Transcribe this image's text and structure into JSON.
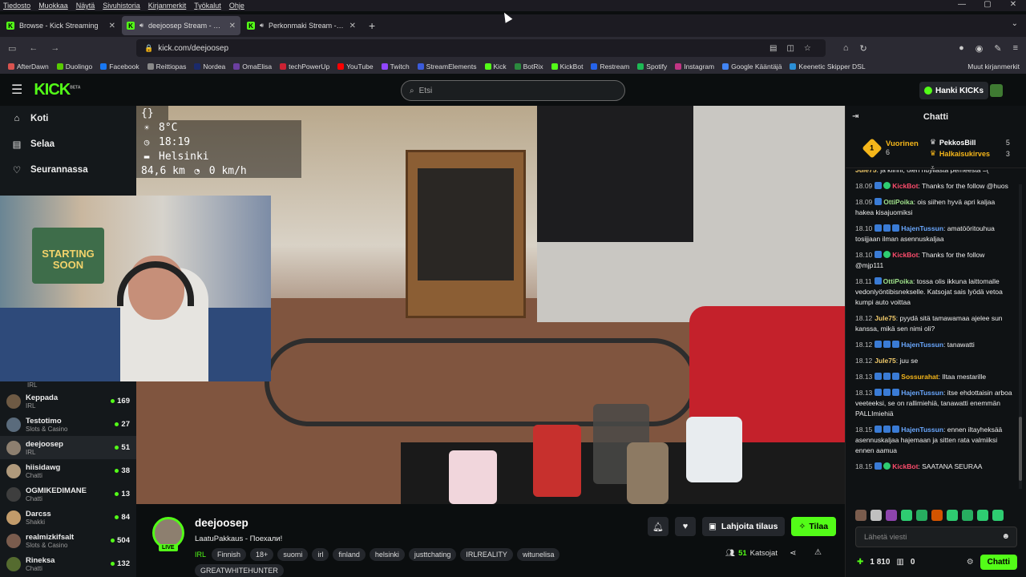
{
  "menubar": [
    "Tiedosto",
    "Muokkaa",
    "Näytä",
    "Sivuhistoria",
    "Kirjanmerkit",
    "Työkalut",
    "Ohje"
  ],
  "tabs": [
    {
      "title": "Browse - Kick Streaming",
      "active": false
    },
    {
      "title": "deejoosep Stream - Watch",
      "active": true
    },
    {
      "title": "Perkonmaki Stream - Watch",
      "active": false
    }
  ],
  "url": "kick.com/deejoosep",
  "bookmarks": [
    "AfterDawn",
    "Duolingo",
    "Facebook",
    "Reittiopas",
    "Nordea",
    "OmaElisa",
    "techPowerUp",
    "YouTube",
    "Twitch",
    "StreamElements",
    "Kick",
    "BotRix",
    "KickBot",
    "Restream",
    "Spotify",
    "Instagram",
    "Google Kääntäjä",
    "Keenetic Skipper DSL"
  ],
  "bookmarks_other": "Muut kirjanmerkit",
  "header": {
    "logo": "KICK",
    "beta": "BETA",
    "search_placeholder": "Etsi",
    "get_kicks": "Hanki KICKs"
  },
  "nav": [
    {
      "label": "Koti",
      "icon": "home-icon"
    },
    {
      "label": "Selaa",
      "icon": "browse-icon"
    },
    {
      "label": "Seurannassa",
      "icon": "heart-icon"
    }
  ],
  "partial_channel_category": "IRL",
  "channels": [
    {
      "name": "Keppada",
      "category": "IRL",
      "viewers": "169"
    },
    {
      "name": "Testotimo",
      "category": "Slots & Casino",
      "viewers": "27"
    },
    {
      "name": "deejoosep",
      "category": "IRL",
      "viewers": "51",
      "selected": true
    },
    {
      "name": "hiisidawg",
      "category": "Chatti",
      "viewers": "38"
    },
    {
      "name": "OGMIKEDIMANE",
      "category": "Chatti",
      "viewers": "13"
    },
    {
      "name": "Darcss",
      "category": "Shakki",
      "viewers": "84"
    },
    {
      "name": "realmizkifsalt",
      "category": "Slots & Casino",
      "viewers": "504"
    },
    {
      "name": "Rineksa",
      "category": "Chatti",
      "viewers": "132"
    }
  ],
  "overlay": {
    "braces": "{}",
    "temp": "8°C",
    "time": "18:19",
    "city": "Helsinki",
    "speed": "84,6 km",
    "speed2": "0 km/h"
  },
  "cam_poster": "STARTING SOON",
  "stream": {
    "name": "deejoosep",
    "live": "LIVE",
    "title": "LaatuPakkaus - Поехали!",
    "category": "IRL",
    "tags": [
      "Finnish",
      "18+",
      "suomi",
      "irl",
      "finland",
      "helsinki",
      "justtchating",
      "IRLREALITY",
      "witunelisa",
      "GREATWHITEHUNTER"
    ],
    "gift_label": "Lahjoita tilaus",
    "subscribe_label": "Tilaa",
    "viewers": "51",
    "viewers_label": "Katsojat"
  },
  "chat": {
    "title": "Chatti",
    "leader_title": "Vuorinen",
    "leader_rank": "1",
    "leader_gifts": "6",
    "leaders": [
      {
        "name": "PekkosBill",
        "value": "5"
      },
      {
        "name": "Halkaisukirves",
        "value": "3"
      }
    ],
    "messages": [
      {
        "time": "",
        "user": "Jule75",
        "color": "#f0c96a",
        "text": "ja kiinni, olen huyllästä perheestä =(",
        "partial": true
      },
      {
        "time": "18.09",
        "user": "KickBot",
        "color": "#ff4d6d",
        "text": "Thanks for the follow @huos",
        "badges": [
          "b",
          "g"
        ]
      },
      {
        "time": "18.09",
        "user": "OttiPoika",
        "color": "#9fe08a",
        "text": "ois siihen hyvä apri kaljaa hakea kisajuomiksi",
        "badges": [
          "b"
        ]
      },
      {
        "time": "18.10",
        "user": "HajenTussun",
        "color": "#6aa8ff",
        "text": "amatööritouhua tosijjaan ilman asennuskaljaa",
        "badges": [
          "b",
          "b",
          "b"
        ]
      },
      {
        "time": "18.10",
        "user": "KickBot",
        "color": "#ff4d6d",
        "text": "Thanks for the follow @mjp111",
        "badges": [
          "b",
          "g"
        ]
      },
      {
        "time": "18.11",
        "user": "OttiPoika",
        "color": "#9fe08a",
        "text": "tossa olis ikkuna laittomalle vedonlyöntibisnekselle. Katsojat sais lyödä vetoa kumpi auto voittaa",
        "badges": [
          "b"
        ]
      },
      {
        "time": "18.12",
        "user": "Jule75",
        "color": "#f0c96a",
        "text": "pyydä sitä tamawamaa ajelee sun kanssa, mikä sen nimi oli?",
        "badges": []
      },
      {
        "time": "18.12",
        "user": "HajenTussun",
        "color": "#6aa8ff",
        "text": "tanawatti",
        "badges": [
          "b",
          "b",
          "b"
        ]
      },
      {
        "time": "18.12",
        "user": "Jule75",
        "color": "#f0c96a",
        "text": "juu se",
        "badges": []
      },
      {
        "time": "18.13",
        "user": "Sossurahat",
        "color": "#f5b61a",
        "text": "Iltaa mestarille",
        "badges": [
          "b",
          "b",
          "b"
        ]
      },
      {
        "time": "18.13",
        "user": "HajenTussun",
        "color": "#6aa8ff",
        "text": "itse ehdottaisin arboa veeteeksi, se on rallimiehiä, tanawatti enemmän PALLImiehiä",
        "badges": [
          "b",
          "b",
          "b"
        ]
      },
      {
        "time": "18.15",
        "user": "HajenTussun",
        "color": "#6aa8ff",
        "text": "ennen iltayheksää asennuskaljaa hajemaan ja sitten rata valmiiksi ennen aamua",
        "badges": [
          "b",
          "b",
          "b"
        ]
      },
      {
        "time": "18.15",
        "user": "KickBot",
        "color": "#ff4d6d",
        "text": "SAATANA SEURAA",
        "badges": [
          "b",
          "g"
        ]
      }
    ],
    "input_placeholder": "Lähetä viesti",
    "points": "1 810",
    "gifts": "0",
    "send_label": "Chatti"
  },
  "colors": {
    "accent": "#53fc18",
    "bg": "#0b0e0f",
    "panel": "#14181b"
  }
}
